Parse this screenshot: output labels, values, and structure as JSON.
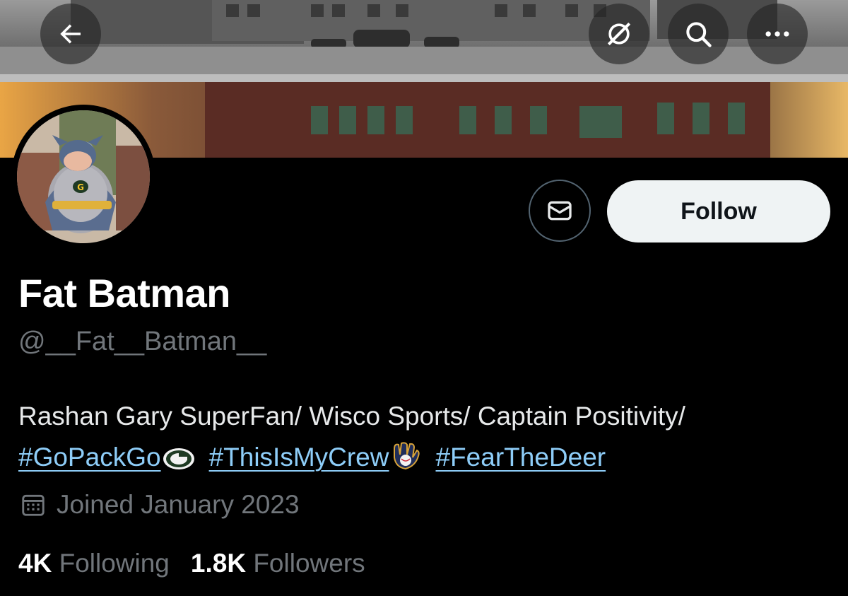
{
  "header": {
    "back_icon": "arrow-left-icon",
    "grok_icon": "slashed-circle-icon",
    "search_icon": "search-icon",
    "more_icon": "more-horizontal-icon"
  },
  "profile": {
    "display_name": "Fat Batman",
    "handle": "@__Fat__Batman__",
    "bio_text": "Rashan Gary SuperFan/ Wisco Sports/ Captain Positivity/",
    "hashtags": [
      "#GoPackGo",
      "#ThisIsMyCrew",
      "#FearTheDeer"
    ],
    "joined": "Joined January 2023"
  },
  "actions": {
    "message_icon": "envelope-icon",
    "follow_label": "Follow"
  },
  "stats": {
    "following_count": "4K",
    "following_label": "Following",
    "followers_count": "1.8K",
    "followers_label": "Followers"
  },
  "colors": {
    "background": "#000000",
    "link": "#8ecdf8",
    "muted": "#71767b",
    "follow_bg": "#eff3f4"
  }
}
